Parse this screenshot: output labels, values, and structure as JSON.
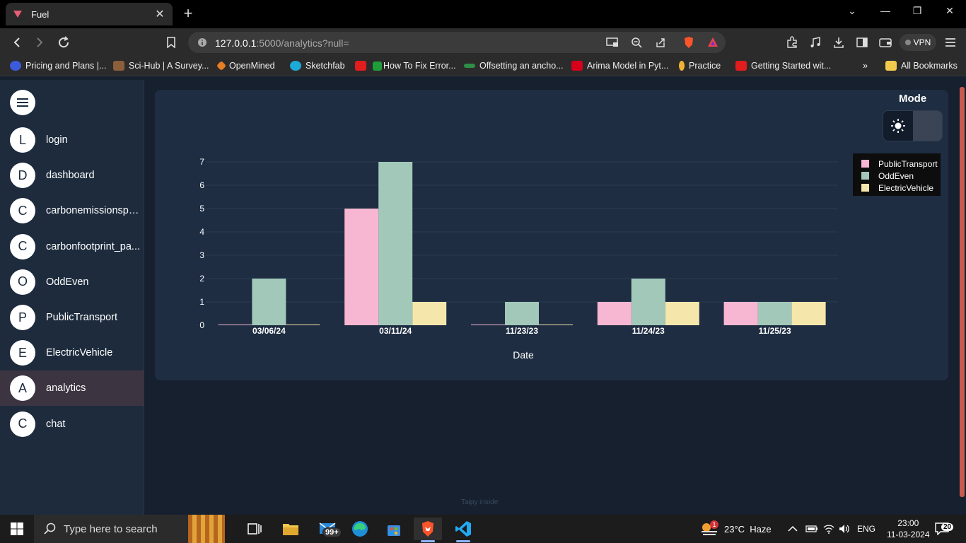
{
  "browser": {
    "tab_title": "Fuel",
    "url_host": "127.0.0.1",
    "url_rest": ":5000/analytics?null=",
    "vpn_label": "VPN"
  },
  "bookmarks": [
    {
      "label": "Pricing and Plans |...",
      "color": "#3b5bdb"
    },
    {
      "label": "Sci-Hub | A Survey...",
      "color": "#8b5e3c"
    },
    {
      "label": "OpenMined",
      "color": "#e67e22"
    },
    {
      "label": "Sketchfab",
      "color": "#1caad9"
    },
    {
      "label": "",
      "color": "#e11d1d"
    },
    {
      "label": "How To Fix Error...",
      "color": "#1f9d3a"
    },
    {
      "label": "Offsetting an ancho...",
      "color": "#2f8d46"
    },
    {
      "label": "Arima Model in Pyt...",
      "color": "#d6001c"
    },
    {
      "label": "Practice",
      "color": "#f2b134"
    },
    {
      "label": "Getting Started wit...",
      "color": "#e11d1d"
    },
    {
      "label": "All Bookmarks",
      "color": "#f2c94c"
    }
  ],
  "sidebar": {
    "items": [
      {
        "initial": "L",
        "label": "login"
      },
      {
        "initial": "D",
        "label": "dashboard"
      },
      {
        "initial": "C",
        "label": "carbonemissionspa..."
      },
      {
        "initial": "C",
        "label": "carbonfootprint_pa..."
      },
      {
        "initial": "O",
        "label": "OddEven"
      },
      {
        "initial": "P",
        "label": "PublicTransport"
      },
      {
        "initial": "E",
        "label": "ElectricVehicle"
      },
      {
        "initial": "A",
        "label": "analytics"
      },
      {
        "initial": "C",
        "label": "chat"
      }
    ],
    "active_index": 7
  },
  "mode": {
    "title": "Mode",
    "selected": "dark"
  },
  "watermark": "Taipy inside",
  "chart_data": {
    "type": "bar",
    "categories": [
      "03/06/24",
      "03/11/24",
      "11/23/23",
      "11/24/23",
      "11/25/23"
    ],
    "series": [
      {
        "name": "PublicTransport",
        "values": [
          0,
          5,
          0,
          1,
          1
        ],
        "color": "#f7b6d2"
      },
      {
        "name": "OddEven",
        "values": [
          2,
          7,
          1,
          2,
          1
        ],
        "color": "#a2c8b9"
      },
      {
        "name": "ElectricVehicle",
        "values": [
          0,
          1,
          0,
          1,
          1
        ],
        "color": "#f5e6ac"
      }
    ],
    "xlabel": "Date",
    "ylabel": "",
    "ylim": [
      0,
      7
    ],
    "yticks": [
      0,
      1,
      2,
      3,
      4,
      5,
      6,
      7
    ],
    "grid": true,
    "legend_position": "top-right"
  },
  "taskbar": {
    "search_placeholder": "Type here to search",
    "mail_badge": "99+",
    "weather": "23°C  Haze",
    "weather_badge": "1",
    "language": "ENG",
    "time": "23:00",
    "date": "11-03-2024",
    "notification_count": "20"
  }
}
